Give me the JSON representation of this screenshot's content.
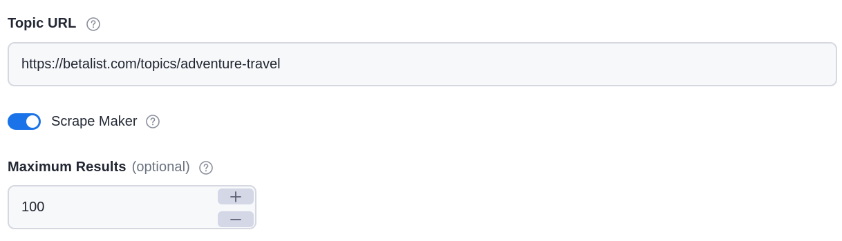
{
  "topic_url": {
    "label": "Topic URL",
    "value": "https://betalist.com/topics/adventure-travel"
  },
  "scrape_maker": {
    "label": "Scrape Maker",
    "enabled": true
  },
  "maximum_results": {
    "label": "Maximum Results",
    "optional_text": "(optional)",
    "value": "100"
  },
  "colors": {
    "accent": "#1a73e8",
    "input_background": "#f7f8fa",
    "input_border": "#d5d8e1",
    "stepper_background": "#d3d7e6",
    "label_text": "#222733",
    "muted_text": "#6b7280"
  },
  "icons": {
    "help": "question-circle-icon",
    "increment": "plus-icon",
    "decrement": "minus-icon"
  }
}
